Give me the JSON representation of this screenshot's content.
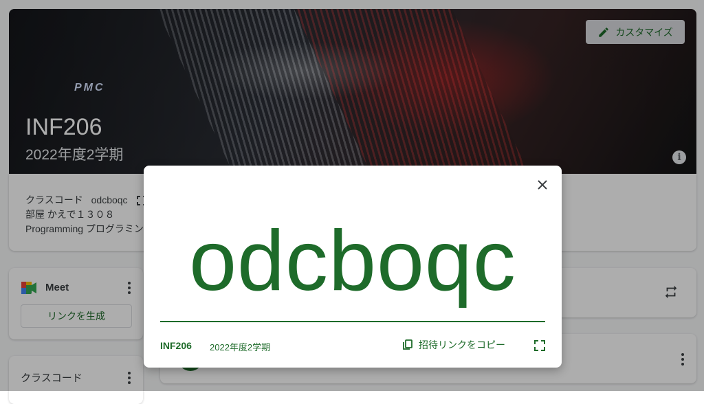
{
  "banner": {
    "logo_text": "PMC",
    "course_title": "INF206",
    "course_term": "2022年度2学期",
    "customize_label": "カスタマイズ"
  },
  "class_info": {
    "class_code_label": "クラスコード",
    "class_code_value": "odcboqc",
    "room_label": "部屋",
    "room_value": "かえで１３０８",
    "subject": "Programming プログラミン"
  },
  "meet_card": {
    "title": "Meet",
    "generate_link_label": "リンクを生成"
  },
  "class_code_card": {
    "title": "クラスコード"
  },
  "dialog": {
    "code": "odcboqc",
    "class_name": "INF206",
    "term": "2022年度2学期",
    "copy_invite_label": "招待リンクをコピー"
  },
  "colors": {
    "accent": "#1e6b2a",
    "overlay": "rgba(0,0,0,0.32)"
  },
  "icons": [
    "pencil-icon",
    "info-icon",
    "fullscreen-icon",
    "meet-logo-icon",
    "more-vert-icon",
    "repeat-icon",
    "close-icon",
    "copy-icon"
  ]
}
